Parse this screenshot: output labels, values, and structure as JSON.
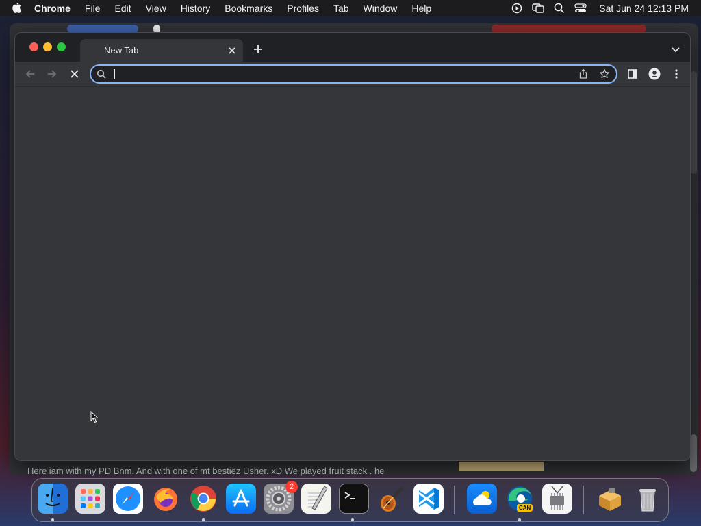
{
  "menubar": {
    "app_name": "Chrome",
    "items": [
      "File",
      "Edit",
      "View",
      "History",
      "Bookmarks",
      "Profiles",
      "Tab",
      "Window",
      "Help"
    ],
    "clock": "Sat Jun 24  12:13 PM"
  },
  "background": {
    "caption": "Here iam with my PD Bnm. And with one of mt bestiez Usher. xD We played fruit stack . he"
  },
  "browser": {
    "tab": {
      "title": "New Tab"
    },
    "omnibox": {
      "value": "",
      "placeholder": ""
    }
  },
  "dock": {
    "items": [
      {
        "name": "Finder",
        "running": true
      },
      {
        "name": "Launchpad",
        "running": false
      },
      {
        "name": "Safari",
        "running": false
      },
      {
        "name": "Firefox",
        "running": false
      },
      {
        "name": "Chrome",
        "running": true
      },
      {
        "name": "App Store",
        "running": false
      },
      {
        "name": "System Settings",
        "running": false,
        "badge": "2"
      },
      {
        "name": "TextEdit",
        "running": false
      },
      {
        "name": "Terminal",
        "running": true
      },
      {
        "name": "GarageBand",
        "running": false
      },
      {
        "name": "Visual Studio Code",
        "running": false
      },
      {
        "name": "Weather",
        "running": false
      },
      {
        "name": "Microsoft Edge Canary",
        "running": true,
        "label": "CAN"
      },
      {
        "name": "System Information",
        "running": false
      },
      {
        "name": "Installer",
        "running": false
      },
      {
        "name": "Trash",
        "running": false
      }
    ]
  },
  "colors": {
    "accent": "#8ab4f8",
    "window_bg": "#35363a",
    "titlebar_bg": "#202124",
    "close": "#ff5f57",
    "minimize": "#febc2e",
    "maximize": "#28c840",
    "badge": "#ff3b30"
  }
}
